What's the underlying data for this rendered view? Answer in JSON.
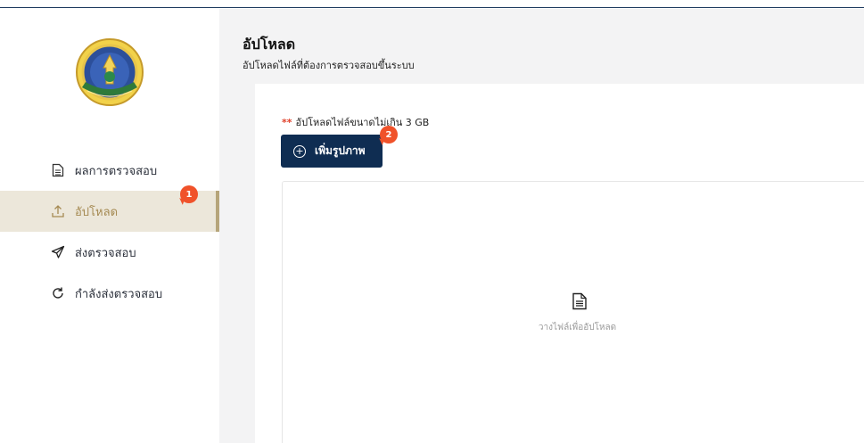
{
  "sidebar": {
    "logo_icon": "university-seal-icon",
    "items": [
      {
        "label": "ผลการตรวจสอบ",
        "icon": "document-icon",
        "active": false
      },
      {
        "label": "อัปโหลด",
        "icon": "upload-icon",
        "active": true,
        "badge": "1"
      },
      {
        "label": "ส่งตรวจสอบ",
        "icon": "send-icon",
        "active": false
      },
      {
        "label": "กำลังส่งตรวจสอบ",
        "icon": "refresh-icon",
        "active": false
      }
    ]
  },
  "header": {
    "title": "อัปโหลด",
    "subtitle": "อัปโหลดไฟล์ที่ต้องการตรวจสอบขึ้นระบบ"
  },
  "upload": {
    "required_mark": "**",
    "limit_note": "อัปโหลดไฟล์ขนาดไม่เกิน 3 GB",
    "add_button_label": "เพิ่มรูปภาพ",
    "add_button_badge": "2",
    "dropzone_text": "วางไฟล์เพื่ออัปโหลด"
  },
  "colors": {
    "primary": "#0f2d52",
    "active_bg": "#ece7da",
    "active_text": "#a58a52",
    "badge": "#f0522a"
  }
}
